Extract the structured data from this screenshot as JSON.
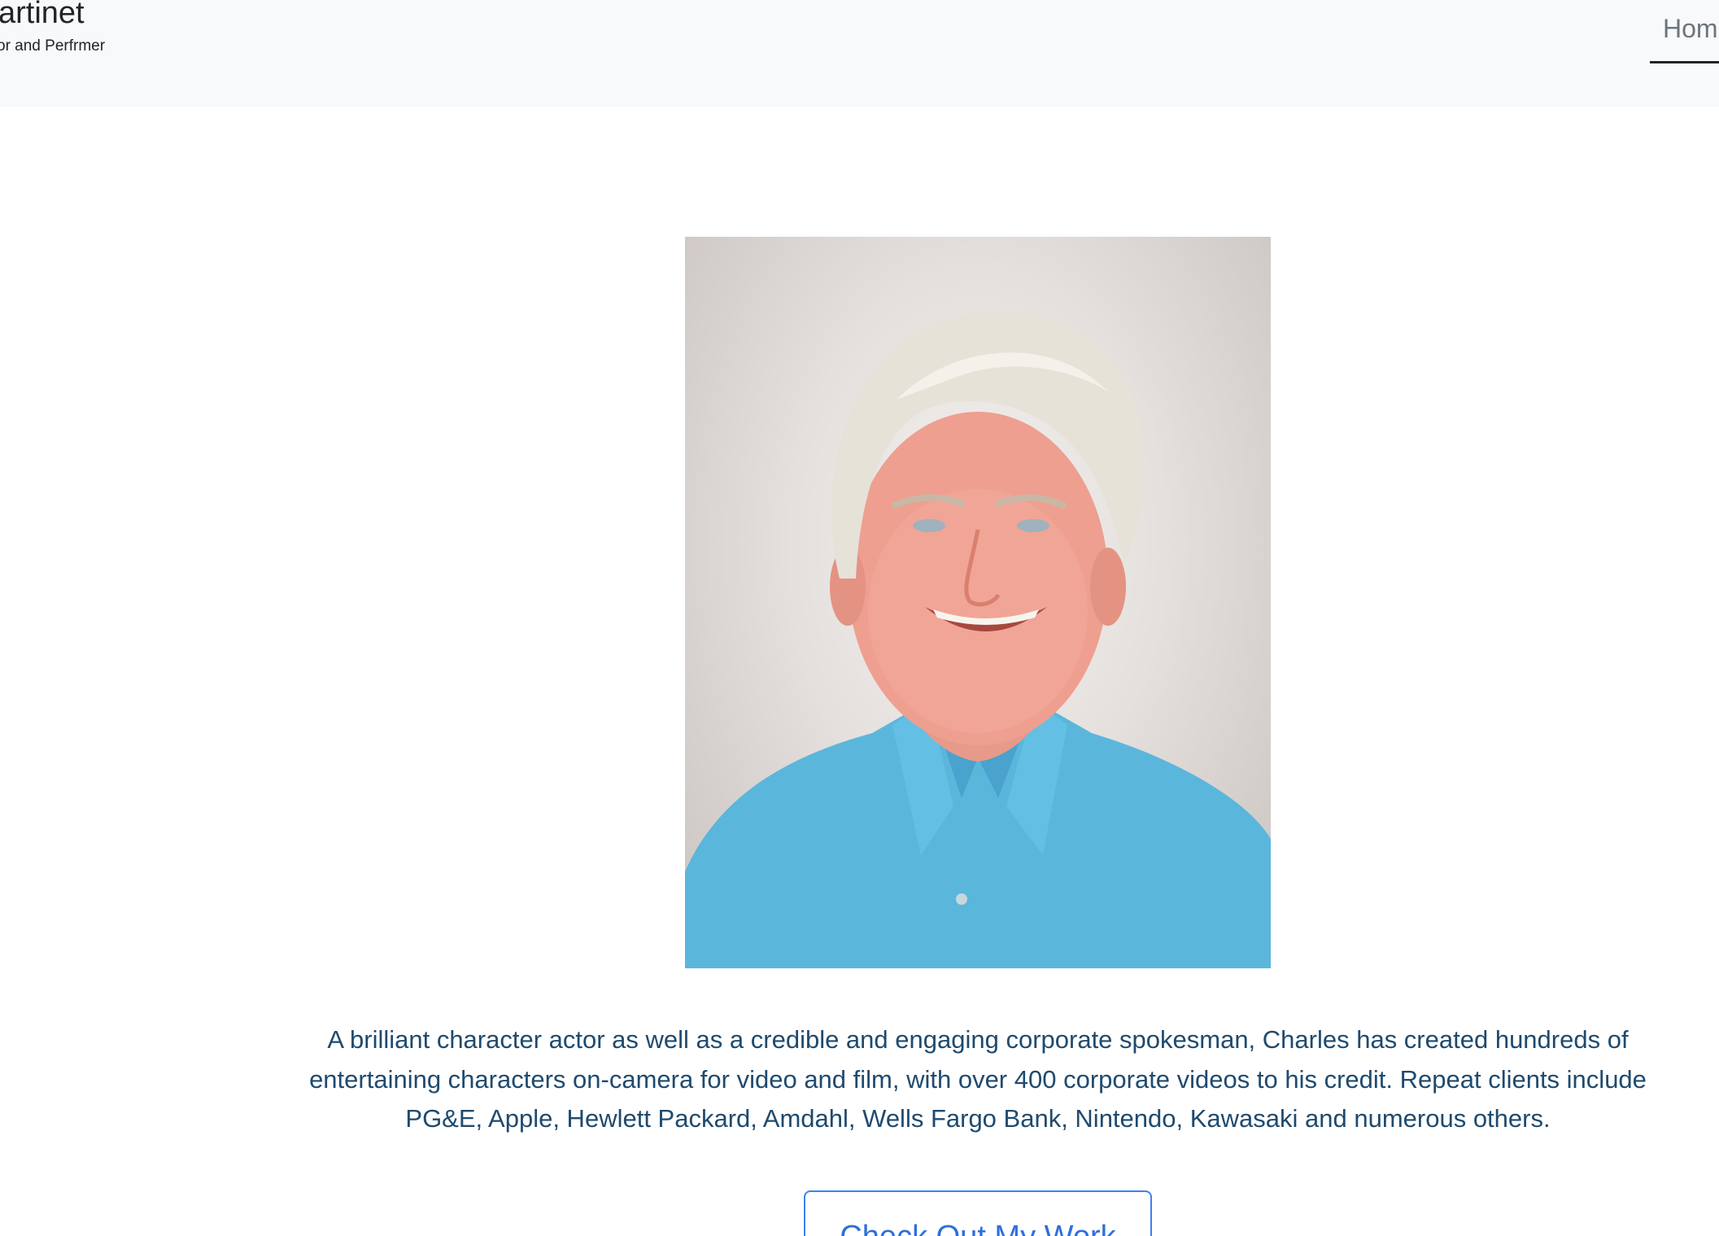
{
  "header": {
    "brand_title": "artinet",
    "brand_subtitle": "or and Perfrmer",
    "nav": {
      "home_label": "Home"
    }
  },
  "hero": {
    "portrait_icon": "portrait-photo",
    "bio": "A brilliant character actor as well as a credible and engaging corporate spokesman, Charles has created hundreds of entertaining characters on-camera for video and film, with over 400 corporate videos to his credit. Repeat clients include PG&E, Apple, Hewlett Packard, Amdahl, Wells Fargo Bank, Nintendo, Kawasaki and numerous others.",
    "cta_label": "Check Out My Work"
  },
  "colors": {
    "navbar_bg": "#f8f9fa",
    "bio_text": "#1f4a6e",
    "cta_accent": "#3b82f6",
    "shirt": "#5bb6dc"
  }
}
